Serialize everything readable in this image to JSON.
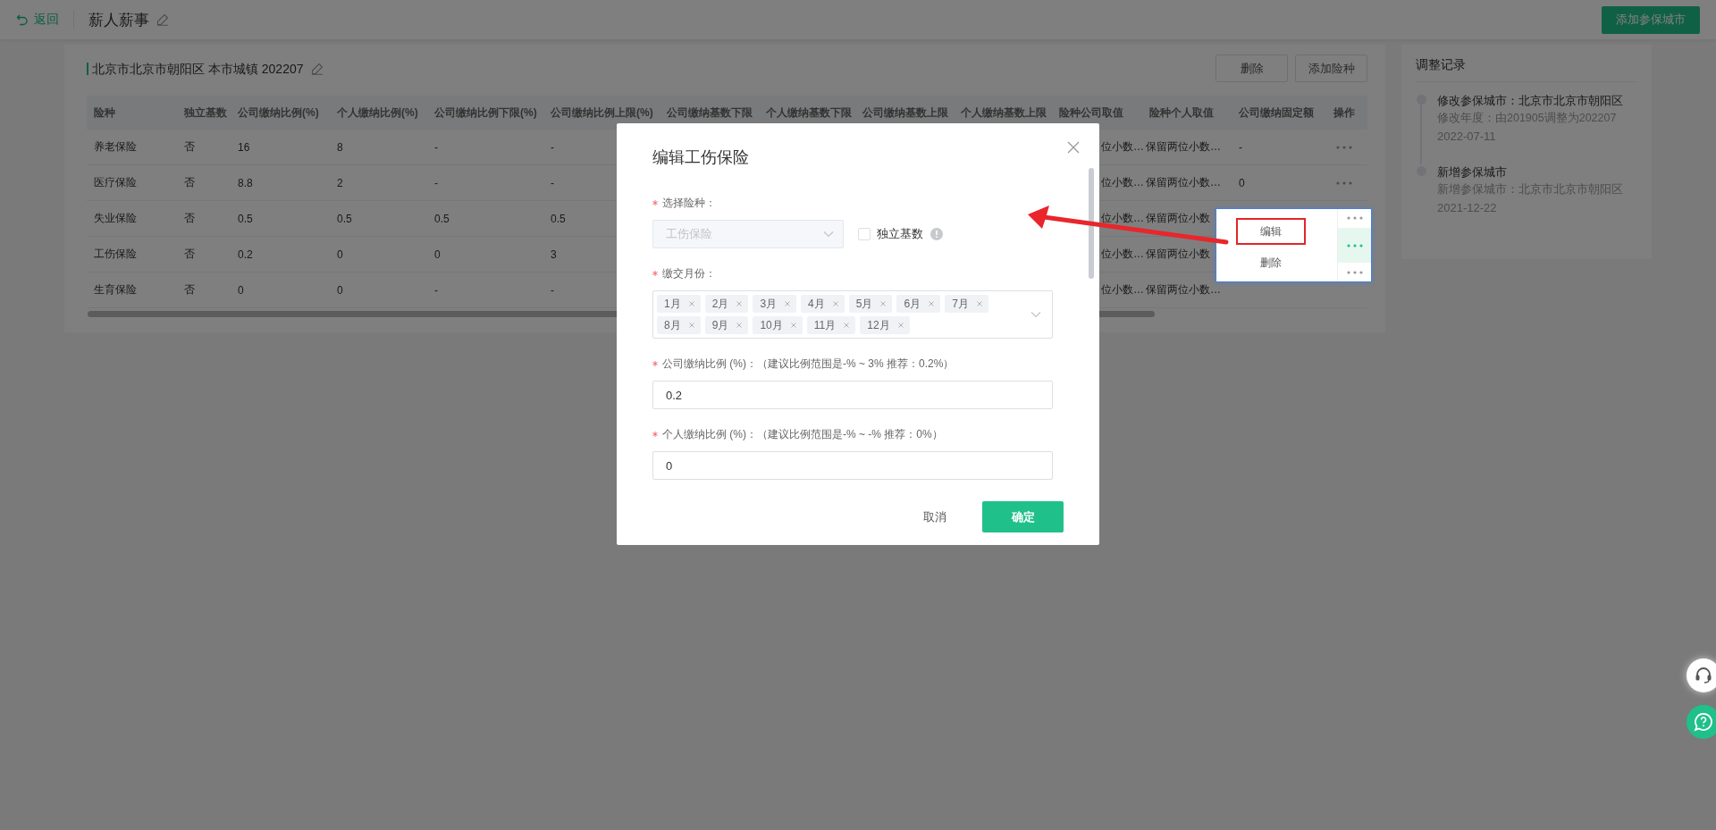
{
  "top_bar": {
    "back_label": "返回",
    "title": "薪人薪事",
    "add_city_button": "添加参保城市"
  },
  "city_card": {
    "title": "北京市北京市朝阳区 本市城镇 202207",
    "buttons": [
      "删除",
      "添加险种"
    ],
    "table": {
      "columns": [
        "险种",
        "独立基数",
        "公司缴纳比例(%)",
        "个人缴纳比例(%)",
        "公司缴纳比例下限(%)",
        "公司缴纳比例上限(%)",
        "公司缴纳基数下限",
        "个人缴纳基数下限",
        "公司缴纳基数上限",
        "个人缴纳基数上限",
        "险种公司取值",
        "险种个人取值",
        "公司缴纳固定额",
        "操作"
      ],
      "rows": [
        {
          "cells": [
            "养老保险",
            "否",
            "16",
            "8",
            "-",
            "-",
            null,
            null,
            null,
            null,
            "位小数…",
            "保留两位小数…",
            "-"
          ]
        },
        {
          "cells": [
            "医疗保险",
            "否",
            "8.8",
            "2",
            "-",
            "-",
            null,
            null,
            null,
            null,
            "位小数…",
            "保留两位小数…",
            "0"
          ]
        },
        {
          "cells": [
            "失业保险",
            "否",
            "0.5",
            "0.5",
            "0.5",
            "0.5",
            null,
            null,
            null,
            null,
            "位小数…",
            "保留两位小数",
            null
          ]
        },
        {
          "cells": [
            "工伤保险",
            "否",
            "0.2",
            "0",
            "0",
            "3",
            null,
            null,
            null,
            null,
            "位小数…",
            "保留两位小数",
            null
          ]
        },
        {
          "cells": [
            "生育保险",
            "否",
            "0",
            "0",
            "-",
            "-",
            null,
            null,
            null,
            null,
            "位小数…",
            "保留两位小数…",
            null
          ]
        }
      ]
    }
  },
  "history": {
    "title": "调整记录",
    "entries": [
      {
        "title": "修改参保城市：北京市北京市朝阳区",
        "detail": "修改年度：由201905调整为202207",
        "date": "2022-07-11"
      },
      {
        "title": "新增参保城市",
        "detail": "新增参保城市：北京市北京市朝阳区",
        "date": "2021-12-22"
      }
    ]
  },
  "dialog": {
    "title": "编辑工伤保险",
    "fields": [
      {
        "kind": "select",
        "label": "选择险种：",
        "required": true,
        "value": "工伤保险",
        "disabled": true,
        "checkbox": {
          "label": "独立基数",
          "checked": false
        }
      },
      {
        "kind": "tags",
        "label": "缴交月份：",
        "required": true,
        "tags": [
          "1月",
          "2月",
          "3月",
          "4月",
          "5月",
          "6月",
          "7月",
          "8月",
          "9月",
          "10月",
          "11月",
          "12月"
        ]
      },
      {
        "kind": "input",
        "label": "公司缴纳比例 (%)：（建议比例范围是-% ~ 3% 推荐：0.2%）",
        "required": true,
        "value": "0.2"
      },
      {
        "kind": "input",
        "label": "个人缴纳比例 (%)：（建议比例范围是-% ~ -% 推荐：0%）",
        "required": true,
        "value": "0"
      }
    ],
    "cancel": "取消",
    "confirm": "确定"
  },
  "action_menu": {
    "items": [
      {
        "label": "编辑",
        "highlighted": true
      },
      {
        "label": "删除",
        "highlighted": false
      }
    ],
    "action_cells": [
      {
        "selected": false
      },
      {
        "selected": true
      },
      {
        "selected": false
      }
    ]
  }
}
